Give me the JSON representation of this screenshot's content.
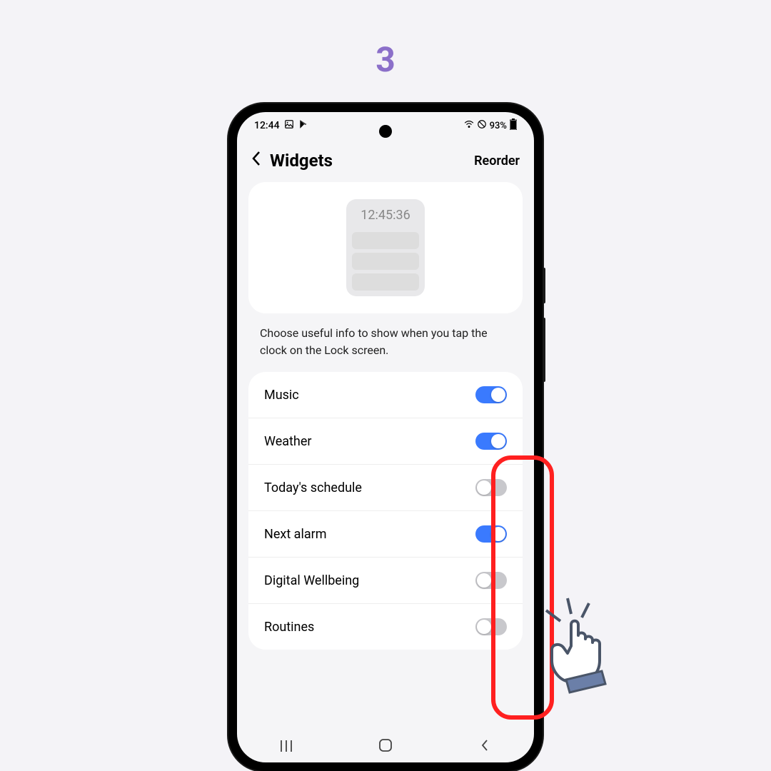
{
  "step": "3",
  "status_bar": {
    "time": "12:44",
    "battery_pct": "93%"
  },
  "header": {
    "title": "Widgets",
    "reorder_label": "Reorder"
  },
  "preview": {
    "time": "12:45:36"
  },
  "description": "Choose useful info to show when you tap the clock on the Lock screen.",
  "options": [
    {
      "label": "Music",
      "on": true
    },
    {
      "label": "Weather",
      "on": true
    },
    {
      "label": "Today's schedule",
      "on": false
    },
    {
      "label": "Next alarm",
      "on": true
    },
    {
      "label": "Digital Wellbeing",
      "on": false
    },
    {
      "label": "Routines",
      "on": false
    }
  ],
  "nav": {
    "recents": "|||",
    "home": "◯",
    "back": "⟨"
  }
}
